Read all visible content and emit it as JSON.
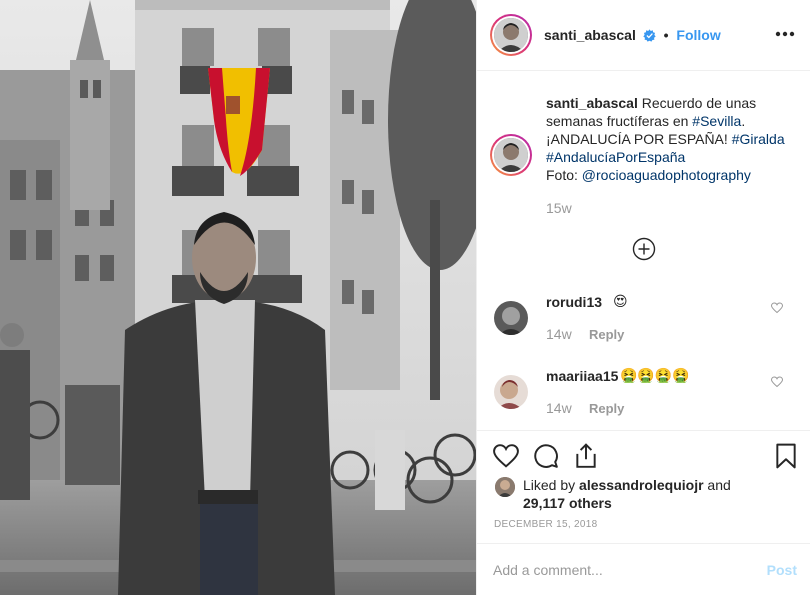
{
  "post": {
    "username": "santi_abascal",
    "separator": "•",
    "follow_label": "Follow",
    "caption": {
      "username": "santi_abascal",
      "text_1": "Recuerdo de unas semanas fructíferas en",
      "tag_sevilla": "#Sevilla",
      "text_2": ". ¡ANDALUCÍA POR ESPAÑA!",
      "tag_giralda": "#Giralda",
      "tag_andalucia": "#AndalucíaPorEspaña",
      "text_foto": "Foto:",
      "mention": "@rocioaguadophotography",
      "time": "15w"
    },
    "comments": [
      {
        "username": "rorudi13",
        "emoji": "😍",
        "time": "14w",
        "reply": "Reply"
      },
      {
        "username": "maariiaa15",
        "emoji": "🤮🤮🤮🤮",
        "time": "14w",
        "reply": "Reply"
      }
    ],
    "likes": {
      "prefix": "Liked by",
      "user": "alessandrolequiojr",
      "and": "and",
      "others": "29,117 others"
    },
    "date": "DECEMBER 15, 2018",
    "comment_placeholder": "Add a comment...",
    "post_label": "Post"
  },
  "icons": {
    "verified": "verified-badge-icon",
    "more": "more-options-icon",
    "load_more": "load-more-comments-icon",
    "heart": "heart-icon",
    "comment": "comment-icon",
    "share": "share-icon",
    "save": "bookmark-icon"
  },
  "colors": {
    "link": "#003569",
    "accent": "#3897f0",
    "muted": "#999999",
    "flag_red": "#c8102e",
    "flag_yellow": "#f1bf00"
  }
}
